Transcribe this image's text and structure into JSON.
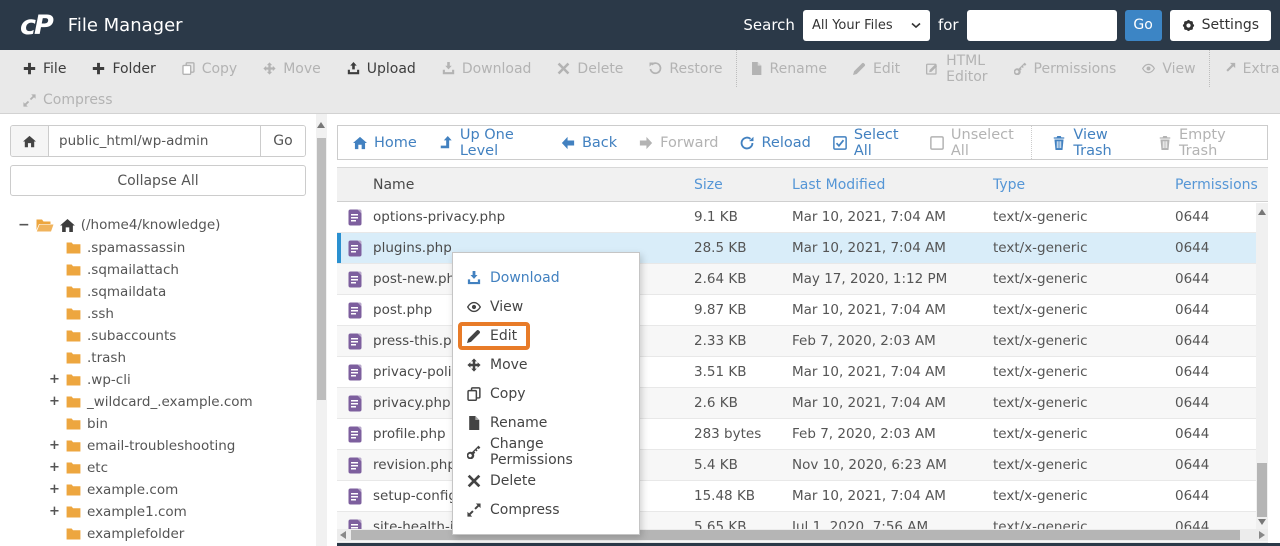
{
  "colors": {
    "header_bg": "#2b3948",
    "accent": "#3c85c5",
    "link": "#4281c0",
    "colhead": "#5596d6",
    "selected": "#d9edf9",
    "selbar": "#2a90d0",
    "orange": "#e87b28",
    "folder": "#eda63f",
    "dim": "#b3b3b3",
    "text": "#3d3d3d"
  },
  "header": {
    "logo": "cP",
    "title": "File Manager",
    "search_label": "Search",
    "search_scope": "All Your Files",
    "for_label": "for",
    "search_value": "",
    "go_label": "Go",
    "settings_label": "Settings"
  },
  "toolbar": {
    "row1": [
      {
        "label": "File",
        "icon": "plus",
        "state": ""
      },
      {
        "label": "Folder",
        "icon": "plus",
        "state": ""
      },
      {
        "label": "Copy",
        "icon": "copy",
        "state": "dim"
      },
      {
        "label": "Move",
        "icon": "move",
        "state": "dim"
      },
      {
        "label": "Upload",
        "icon": "upload",
        "state": ""
      },
      {
        "label": "Download",
        "icon": "download",
        "state": "dim"
      },
      {
        "label": "Delete",
        "icon": "x",
        "state": "dim"
      },
      {
        "label": "Restore",
        "icon": "restore",
        "state": "dim"
      },
      {
        "label": "Rename",
        "icon": "file",
        "state": "dim sep"
      },
      {
        "label": "Edit",
        "icon": "pencil",
        "state": "dim"
      },
      {
        "label": "HTML Editor",
        "icon": "html",
        "state": "dim"
      },
      {
        "label": "Permissions",
        "icon": "key",
        "state": "dim"
      },
      {
        "label": "View",
        "icon": "eye",
        "state": "dim"
      },
      {
        "label": "Extract",
        "icon": "extract",
        "state": "dim sep"
      }
    ],
    "row2": [
      {
        "label": "Compress",
        "icon": "compress",
        "state": "dim"
      }
    ]
  },
  "sidebar": {
    "path_value": "public_html/wp-admin",
    "go_label": "Go",
    "collapse_label": "Collapse All",
    "root_prefix": "−",
    "root_label": "(/home4/knowledge)",
    "items": [
      {
        "prefix": "",
        "label": ".spamassassin"
      },
      {
        "prefix": "",
        "label": ".sqmailattach"
      },
      {
        "prefix": "",
        "label": ".sqmaildata"
      },
      {
        "prefix": "",
        "label": ".ssh"
      },
      {
        "prefix": "",
        "label": ".subaccounts"
      },
      {
        "prefix": "",
        "label": ".trash"
      },
      {
        "prefix": "+",
        "label": ".wp-cli"
      },
      {
        "prefix": "+",
        "label": "_wildcard_.example.com"
      },
      {
        "prefix": "",
        "label": "bin"
      },
      {
        "prefix": "+",
        "label": "email-troubleshooting"
      },
      {
        "prefix": "+",
        "label": "etc"
      },
      {
        "prefix": "+",
        "label": "example.com"
      },
      {
        "prefix": "+",
        "label": "example1.com"
      },
      {
        "prefix": "",
        "label": "examplefolder"
      }
    ]
  },
  "nav": {
    "items": [
      {
        "label": "Home",
        "icon": "home",
        "state": ""
      },
      {
        "label": "Up One Level",
        "icon": "arrow-up",
        "state": ""
      },
      {
        "label": "Back",
        "icon": "arrow-left",
        "state": ""
      },
      {
        "label": "Forward",
        "icon": "arrow-right",
        "state": "dim"
      },
      {
        "label": "Reload",
        "icon": "reload",
        "state": ""
      },
      {
        "label": "Select All",
        "icon": "check-square",
        "state": ""
      },
      {
        "label": "Unselect All",
        "icon": "square",
        "state": "dim"
      },
      {
        "label": "View Trash",
        "icon": "trash",
        "state": "pushright"
      },
      {
        "label": "Empty Trash",
        "icon": "trash",
        "state": "dim"
      }
    ]
  },
  "table": {
    "columns": [
      "Name",
      "Size",
      "Last Modified",
      "Type",
      "Permissions"
    ],
    "rows": [
      {
        "name": "options-privacy.php",
        "size": "9.1 KB",
        "modified": "Mar 10, 2021, 7:04 AM",
        "type": "text/x-generic",
        "perms": "0644",
        "state": ""
      },
      {
        "name": "plugins.php",
        "size": "28.5 KB",
        "modified": "Mar 10, 2021, 7:04 AM",
        "type": "text/x-generic",
        "perms": "0644",
        "state": "selected"
      },
      {
        "name": "post-new.ph",
        "size": "2.64 KB",
        "modified": "May 17, 2020, 1:12 PM",
        "type": "text/x-generic",
        "perms": "0644",
        "state": "stripe"
      },
      {
        "name": "post.php",
        "size": "9.87 KB",
        "modified": "Mar 10, 2021, 7:04 AM",
        "type": "text/x-generic",
        "perms": "0644",
        "state": ""
      },
      {
        "name": "press-this.pl",
        "size": "2.33 KB",
        "modified": "Feb 7, 2020, 2:03 AM",
        "type": "text/x-generic",
        "perms": "0644",
        "state": "stripe"
      },
      {
        "name": "privacy-polic",
        "size": "3.51 KB",
        "modified": "Mar 10, 2021, 7:04 AM",
        "type": "text/x-generic",
        "perms": "0644",
        "state": ""
      },
      {
        "name": "privacy.php",
        "size": "2.6 KB",
        "modified": "Mar 10, 2021, 7:04 AM",
        "type": "text/x-generic",
        "perms": "0644",
        "state": "stripe"
      },
      {
        "name": "profile.php",
        "size": "283 bytes",
        "modified": "Feb 7, 2020, 2:03 AM",
        "type": "text/x-generic",
        "perms": "0644",
        "state": ""
      },
      {
        "name": "revision.php",
        "size": "5.4 KB",
        "modified": "Nov 10, 2020, 6:23 AM",
        "type": "text/x-generic",
        "perms": "0644",
        "state": "stripe"
      },
      {
        "name": "setup-config",
        "size": "15.48 KB",
        "modified": "Mar 10, 2021, 7:04 AM",
        "type": "text/x-generic",
        "perms": "0644",
        "state": ""
      },
      {
        "name": "site-health-info.php",
        "size": "5.65 KB",
        "modified": "Jul 1, 2020, 7:56 AM",
        "type": "text/x-generic",
        "perms": "0644",
        "state": "stripe"
      }
    ]
  },
  "context_menu": {
    "items": [
      {
        "label": "Download",
        "icon": "download",
        "state": "primary"
      },
      {
        "label": "View",
        "icon": "eye",
        "state": ""
      },
      {
        "label": "Edit",
        "icon": "pencil",
        "state": "highlight"
      },
      {
        "label": "Move",
        "icon": "move",
        "state": ""
      },
      {
        "label": "Copy",
        "icon": "copy",
        "state": ""
      },
      {
        "label": "Rename",
        "icon": "file",
        "state": ""
      },
      {
        "label": "Change Permissions",
        "icon": "key",
        "state": ""
      },
      {
        "label": "Delete",
        "icon": "x",
        "state": ""
      },
      {
        "label": "Compress",
        "icon": "compress",
        "state": ""
      }
    ]
  }
}
